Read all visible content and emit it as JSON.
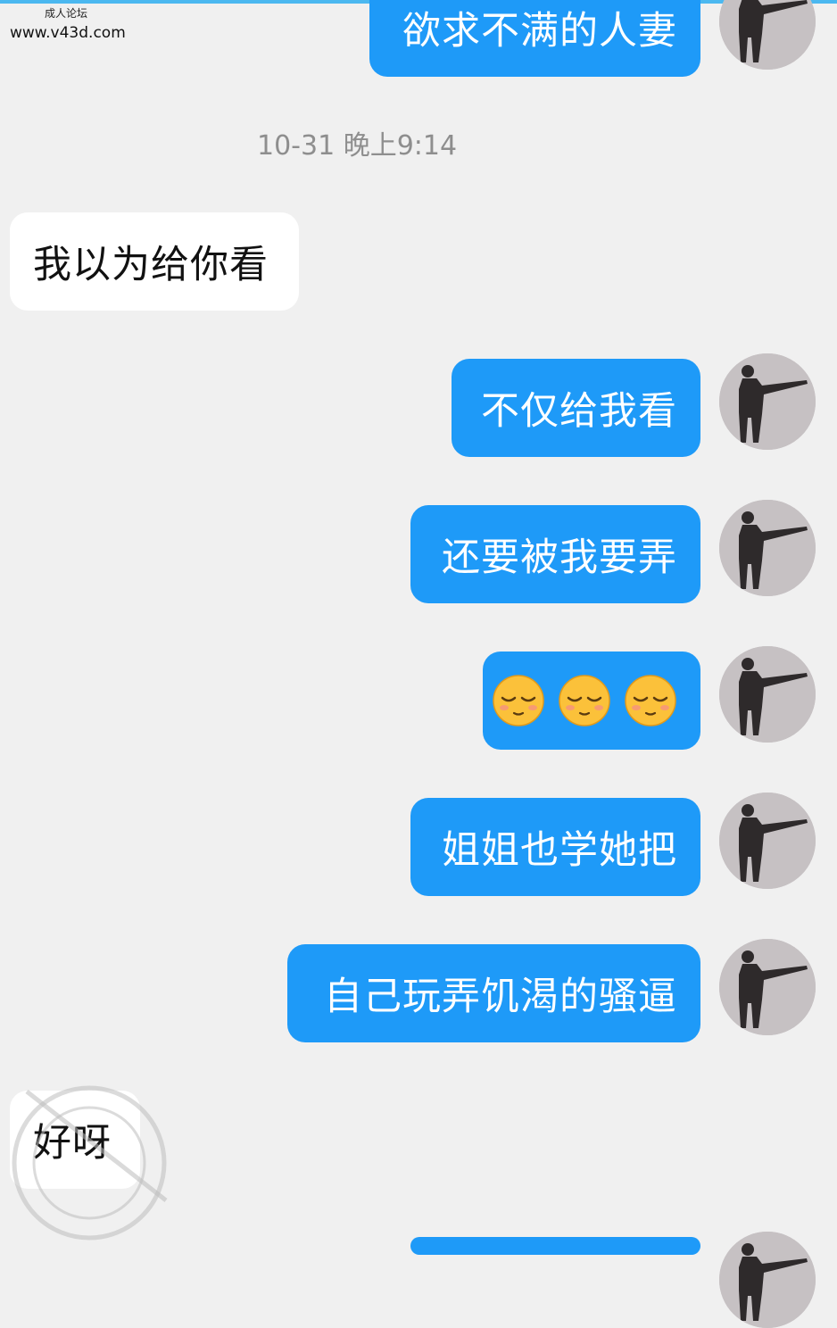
{
  "watermark": {
    "small": "成人论坛",
    "url": "www.v43d.com"
  },
  "timestamp": "10-31 晚上9:14",
  "messages": [
    {
      "text": "欲求不满的人妻"
    },
    {
      "text": "我以为给你看"
    },
    {
      "text": "不仅给我看"
    },
    {
      "text": "还要被我要弄"
    },
    {
      "emoji": [
        "relieved-face",
        "relieved-face",
        "relieved-face"
      ]
    },
    {
      "text": "姐姐也学她把"
    },
    {
      "text": "自己玩弄饥渴的骚逼"
    },
    {
      "text": "好呀"
    }
  ],
  "colors": {
    "outgoing": "#1e9af8",
    "incoming": "#ffffff",
    "background": "#f0f0f0"
  }
}
